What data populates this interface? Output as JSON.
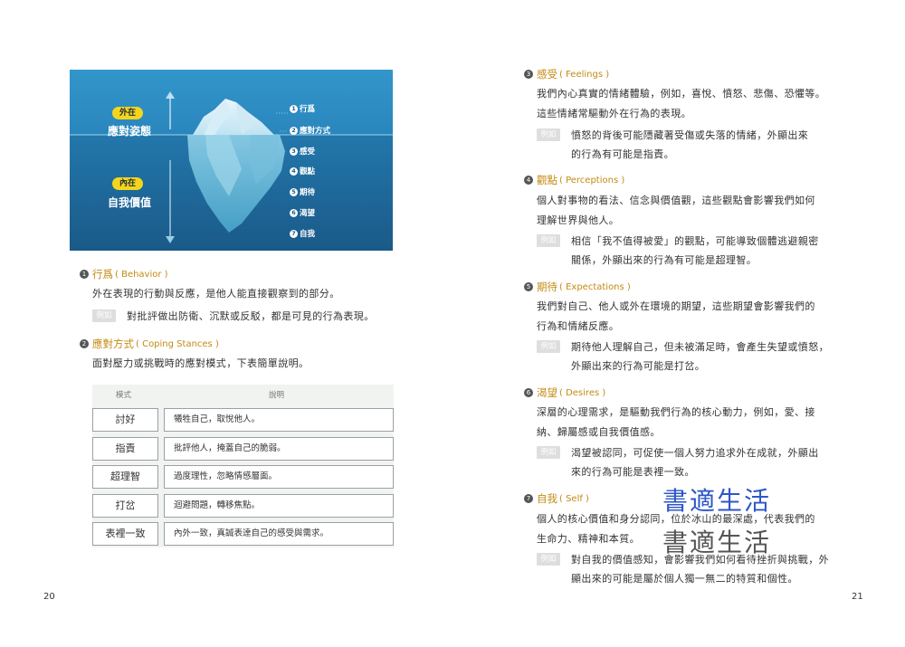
{
  "left_page": {
    "page_number": "20",
    "figure": {
      "outer_tag": "外在",
      "outer_label": "應對姿態",
      "inner_tag": "內在",
      "inner_label": "自我價值",
      "items": [
        {
          "num": "1",
          "label": "行爲"
        },
        {
          "num": "2",
          "label": "應對方式"
        },
        {
          "num": "3",
          "label": "感受"
        },
        {
          "num": "4",
          "label": "觀點"
        },
        {
          "num": "5",
          "label": "期待"
        },
        {
          "num": "6",
          "label": "渴望"
        },
        {
          "num": "7",
          "label": "自我"
        }
      ]
    },
    "sections": [
      {
        "num": "1",
        "title": "行爲",
        "en": "( Behavior )",
        "body": "外在表現的行動與反應，是他人能直接觀察到的部分。",
        "example_tag": "例如",
        "example": "對批評做出防衛、沉默或反駁，都是可見的行為表現。"
      },
      {
        "num": "2",
        "title": "應對方式",
        "en": "( Coping Stances )",
        "body": "面對壓力或挑戰時的應對模式，下表簡單說明。"
      }
    ],
    "table": {
      "headers": [
        "模式",
        "說明"
      ],
      "rows": [
        {
          "mode": "討好",
          "desc": "犧牲自己，取悅他人。"
        },
        {
          "mode": "指責",
          "desc": "批評他人，掩蓋自己的脆弱。"
        },
        {
          "mode": "超理智",
          "desc": "過度理性，忽略情感層面。"
        },
        {
          "mode": "打岔",
          "desc": "迴避問題，轉移焦點。"
        },
        {
          "mode": "表裡一致",
          "desc": "內外一致，真誠表達自己的感受與需求。"
        }
      ]
    }
  },
  "right_page": {
    "page_number": "21",
    "sections": [
      {
        "num": "3",
        "title": "感受",
        "en": "( Feelings )",
        "body_lines": [
          "我們內心真實的情緒體驗，例如，喜悅、憤怒、悲傷、恐懼等。",
          "這些情緒常驅動外在行為的表現。"
        ],
        "example_tag": "例如",
        "example_lines": [
          "憤怒的背後可能隱藏著受傷或失落的情緒，外顯出來",
          "的行為有可能是指責。"
        ]
      },
      {
        "num": "4",
        "title": "觀點",
        "en": "( Perceptions )",
        "body_lines": [
          "個人對事物的看法、信念與價值觀，這些觀點會影響我們如何",
          "理解世界與他人。"
        ],
        "example_tag": "例如",
        "example_lines": [
          "相信「我不值得被愛」的觀點，可能導致個體逃避親密",
          "關係，外顯出來的行為有可能是超理智。"
        ]
      },
      {
        "num": "5",
        "title": "期待",
        "en": "( Expectations )",
        "body_lines": [
          "我們對自己、他人或外在環境的期望，這些期望會影響我們的",
          "行為和情緒反應。"
        ],
        "example_tag": "例如",
        "example_lines": [
          "期待他人理解自己，但未被滿足時，會產生失望或憤怒，",
          "外顯出來的行為可能是打岔。"
        ]
      },
      {
        "num": "6",
        "title": "渴望",
        "en": "( Desires )",
        "body_lines": [
          "深層的心理需求，是驅動我們行為的核心動力，例如，愛、接",
          "納、歸屬感或自我價值感。"
        ],
        "example_tag": "例如",
        "example_lines": [
          "渴望被認同，可促使一個人努力追求外在成就，外顯出",
          "來的行為可能是表裡一致。"
        ]
      },
      {
        "num": "7",
        "title": "自我",
        "en": "( Self )",
        "body_lines": [
          "個人的核心價值和身分認同，位於冰山的最深處，代表我們的",
          "生命力、精神和本質。"
        ],
        "example_tag": "例如",
        "example_lines": [
          "對自我的價值感知，會影響我們如何看待挫折與挑戰，外",
          "顯出來的可能是屬於個人獨一無二的特質和個性。"
        ]
      }
    ],
    "watermark_text": "書適生活",
    "watermark_colors": [
      "#2d57c8",
      "#555555"
    ]
  },
  "colors": {
    "accent": "#c48a12",
    "figure_sky": "#2e8fc4",
    "figure_water": "#1d5e8e",
    "pill": "#f5d51c",
    "example_tag": "#dedede",
    "table_bg": "#f1f3f1"
  }
}
